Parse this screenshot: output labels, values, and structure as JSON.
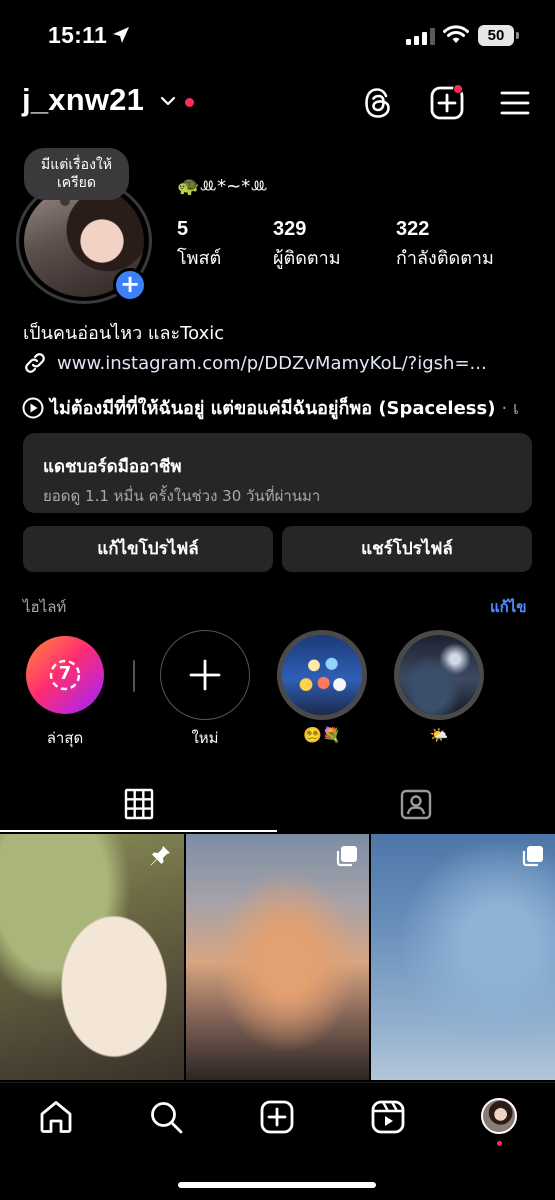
{
  "status_bar": {
    "time": "15:11",
    "battery": "50"
  },
  "header": {
    "username": "j_xnw21"
  },
  "profile": {
    "note": "มีแต่เรื่องให้\nเครียด",
    "display_name": "🐢ꔛ*~*ꔛ",
    "stats": [
      {
        "value": "5",
        "label": "โพสต์"
      },
      {
        "value": "329",
        "label": "ผู้ติดตาม"
      },
      {
        "value": "322",
        "label": "กำลังติดตาม"
      }
    ],
    "bio": "เป็นคนอ่อนไหว และToxic",
    "link": "www.instagram.com/p/DDZvMamyKoL/?igsh=...",
    "music": "ไม่ต้องมีที่ที่ให้ฉันอยู่ แต่ขอแค่มีฉันอยู่ก็พอ (Spaceless)",
    "music_sep": "· เ"
  },
  "dashboard": {
    "title": "แดชบอร์ดมืออาชีพ",
    "subtitle": "ยอดดู 1.1 หมื่น ครั้งในช่วง 30 วันที่ผ่านมา"
  },
  "buttons": {
    "edit_profile": "แก้ไขโปรไฟล์",
    "share_profile": "แชร์โปรไฟล์"
  },
  "highlights": {
    "label": "ไฮไลท์",
    "edit": "แก้ไข",
    "items": [
      {
        "caption": "ล่าสุด",
        "badge": "7"
      },
      {
        "caption": "ใหม่"
      },
      {
        "caption": "😵‍💫💐"
      },
      {
        "caption": "🌤️"
      }
    ]
  },
  "colors": {
    "accent": "#4c8dff",
    "notification": "#ff2d55",
    "surface": "#262626"
  }
}
